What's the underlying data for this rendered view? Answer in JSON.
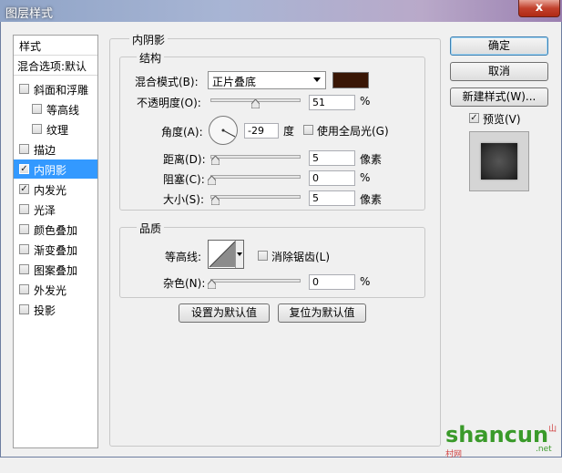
{
  "window": {
    "title": "图层样式",
    "close": "x"
  },
  "style_list": {
    "header": "样式",
    "blend_default": "混合选项:默认",
    "items": [
      {
        "label": "斜面和浮雕",
        "checked": false
      },
      {
        "label": "等高线",
        "checked": false
      },
      {
        "label": "纹理",
        "checked": false
      },
      {
        "label": "描边",
        "checked": false
      },
      {
        "label": "内阴影",
        "checked": true
      },
      {
        "label": "内发光",
        "checked": true
      },
      {
        "label": "光泽",
        "checked": false
      },
      {
        "label": "颜色叠加",
        "checked": false
      },
      {
        "label": "渐变叠加",
        "checked": false
      },
      {
        "label": "图案叠加",
        "checked": false
      },
      {
        "label": "外发光",
        "checked": false
      },
      {
        "label": "投影",
        "checked": false
      }
    ]
  },
  "inner_shadow": {
    "title": "内阴影",
    "structure": {
      "title": "结构",
      "blend_mode_label": "混合模式(B):",
      "blend_mode_value": "正片叠底",
      "shadow_color": "#3a1706",
      "opacity_label": "不透明度(O):",
      "opacity_value": "51",
      "opacity_unit": "%",
      "angle_label": "角度(A):",
      "angle_value": "-29",
      "angle_unit": "度",
      "global_light_label": "使用全局光(G)",
      "global_light_checked": false,
      "distance_label": "距离(D):",
      "distance_value": "5",
      "distance_unit": "像素",
      "choke_label": "阻塞(C):",
      "choke_value": "0",
      "choke_unit": "%",
      "size_label": "大小(S):",
      "size_value": "5",
      "size_unit": "像素"
    },
    "quality": {
      "title": "品质",
      "contour_label": "等高线:",
      "antialias_label": "消除锯齿(L)",
      "antialias_checked": false,
      "noise_label": "杂色(N):",
      "noise_value": "0",
      "noise_unit": "%"
    },
    "set_default": "设置为默认值",
    "reset_default": "复位为默认值"
  },
  "actions": {
    "ok": "确定",
    "cancel": "取消",
    "new_style": "新建样式(W)...",
    "preview_label": "预览(V)",
    "preview_checked": true
  },
  "watermark": {
    "text": "shancun",
    "sub": "山村网",
    "domain": ".net"
  }
}
